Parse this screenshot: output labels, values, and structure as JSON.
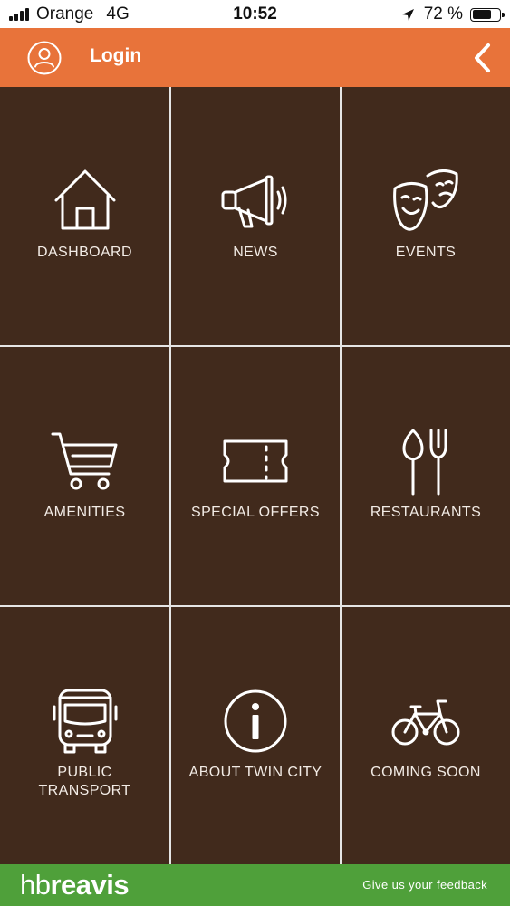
{
  "status_bar": {
    "carrier": "Orange",
    "network": "4G",
    "time": "10:52",
    "battery_text": "72 %",
    "battery_level": 0.72,
    "signal_bars": 4
  },
  "header": {
    "login_label": "Login",
    "background": "#e8733a"
  },
  "menu": {
    "tile_color": "#412a1c",
    "items": [
      {
        "label": "DASHBOARD",
        "icon": "house-icon"
      },
      {
        "label": "NEWS",
        "icon": "megaphone-icon"
      },
      {
        "label": "EVENTS",
        "icon": "theater-masks-icon"
      },
      {
        "label": "AMENITIES",
        "icon": "shopping-cart-icon"
      },
      {
        "label": "SPECIAL OFFERS",
        "icon": "ticket-icon"
      },
      {
        "label": "RESTAURANTS",
        "icon": "cutlery-icon"
      },
      {
        "label": "PUBLIC\nTRANSPORT",
        "icon": "bus-icon"
      },
      {
        "label": "ABOUT TWIN CITY",
        "icon": "info-icon"
      },
      {
        "label": "COMING SOON",
        "icon": "bicycle-icon"
      }
    ]
  },
  "footer": {
    "brand_part1": "hb",
    "brand_part2": "reavis",
    "feedback_label": "Give us your feedback",
    "background": "#4fa03a"
  }
}
